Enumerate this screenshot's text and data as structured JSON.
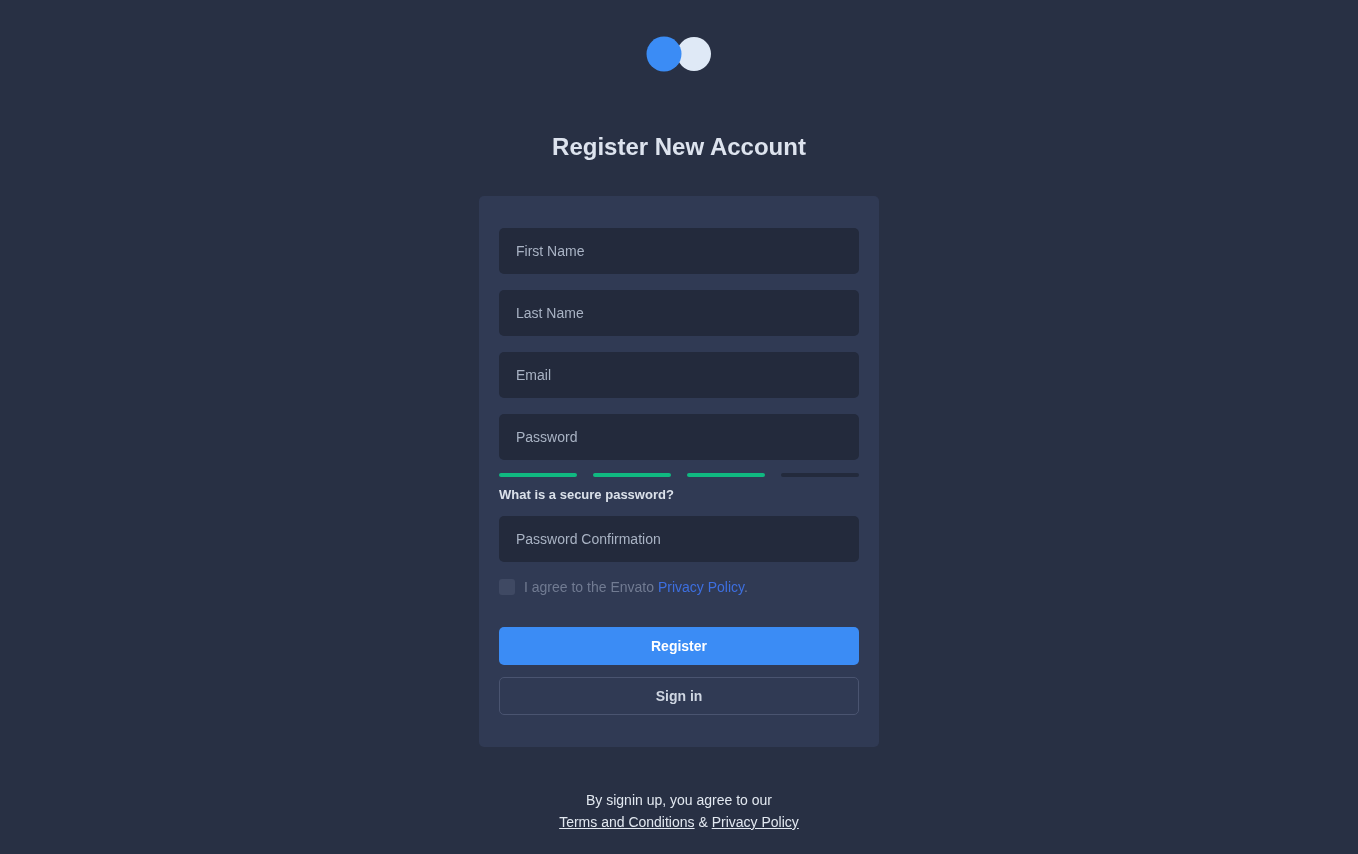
{
  "title": "Register New Account",
  "fields": [
    {
      "placeholder": "First Name"
    },
    {
      "placeholder": "Last Name"
    },
    {
      "placeholder": "Email"
    },
    {
      "placeholder": "Password"
    }
  ],
  "strength": [
    {
      "on": true
    },
    {
      "on": true
    },
    {
      "on": true
    },
    {
      "on": false
    }
  ],
  "password_help": "What is a secure password?",
  "confirm_field": {
    "placeholder": "Password Confirmation"
  },
  "agree": {
    "checked": false,
    "text_before": "I agree to the Envato ",
    "link": "Privacy Policy",
    "text_after": "."
  },
  "buttons": [
    {
      "label": "Register",
      "kind": "primary"
    },
    {
      "label": "Sign in",
      "kind": "outline"
    }
  ],
  "footer": {
    "text": "By signin up, you agree to our",
    "link_1": "Terms and Conditions",
    "separator": "&",
    "link_2": "Privacy Policy"
  }
}
